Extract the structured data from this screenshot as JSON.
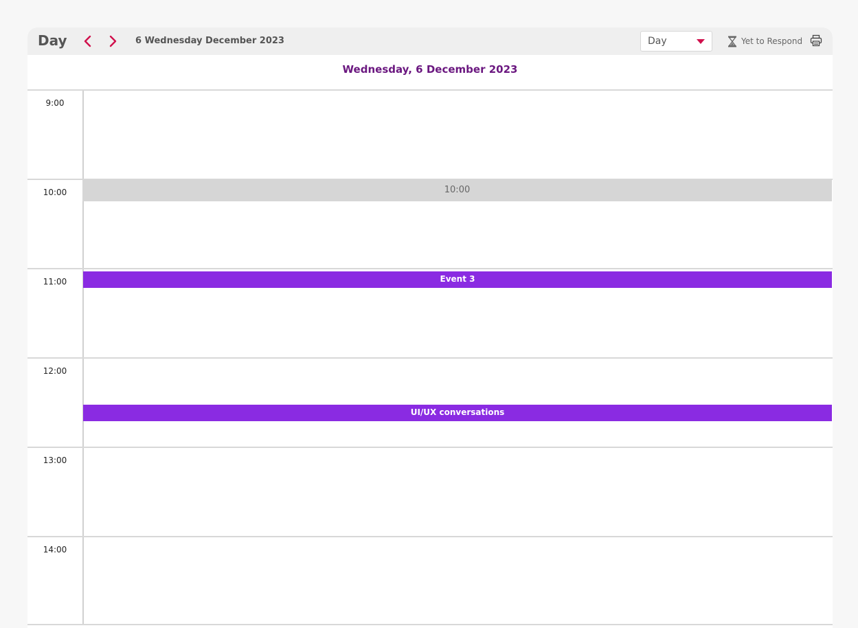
{
  "toolbar": {
    "view_title": "Day",
    "prev_icon": "chevron-left-icon",
    "next_icon": "chevron-right-icon",
    "current_date": "6 Wednesday December 2023",
    "view_select_value": "Day",
    "yet_to_respond_label": "Yet to Respond",
    "accent_color": "#d0104c"
  },
  "day_header": {
    "label": "Wednesday, 6 December 2023",
    "color": "#6b1880"
  },
  "time_slots": [
    "9:00",
    "10:00",
    "11:00",
    "12:00",
    "13:00",
    "14:00"
  ],
  "current_time_marker": "10:00",
  "events": [
    {
      "title": "Event 3",
      "color": "#8a2be2"
    },
    {
      "title": "UI/UX conversations",
      "color": "#8a2be2"
    }
  ]
}
